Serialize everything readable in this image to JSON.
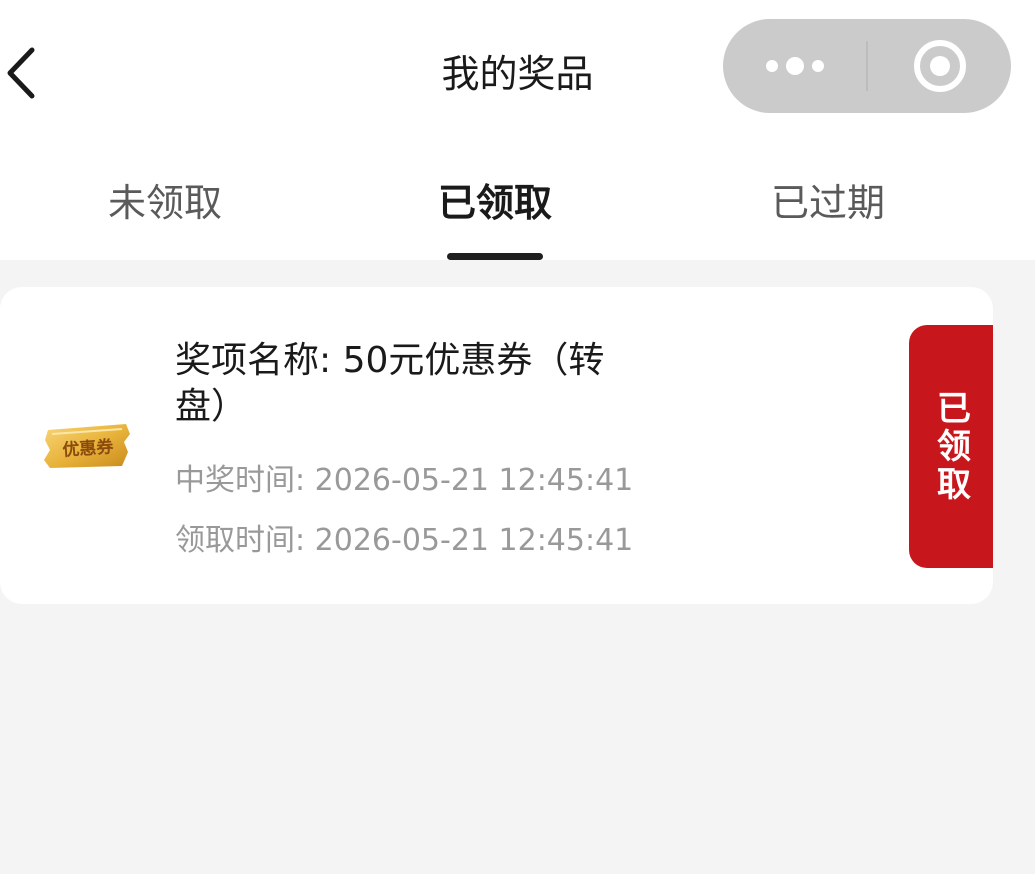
{
  "header": {
    "title": "我的奖品",
    "back_icon": "chevron-left-icon",
    "capsule": {
      "more_icon": "more-dots-icon",
      "close_icon": "target-close-icon"
    }
  },
  "tabs": [
    {
      "label": "未领取",
      "active": false
    },
    {
      "label": "已领取",
      "active": true
    },
    {
      "label": "已过期",
      "active": false
    }
  ],
  "prizes": [
    {
      "name": "奖项名称: 50元优惠券（转盘）",
      "coupon_badge_text": "优惠券",
      "won_time": "中奖时间: 2026-05-21 12:45:41",
      "claim_time": "领取时间: 2026-05-21 12:45:41",
      "status": "已领取"
    }
  ],
  "colors": {
    "page_background": "#f4f4f4",
    "card_background": "#ffffff",
    "status_red": "#c8161d",
    "coupon_gold": "#e9b43c",
    "secondary_text": "#999999",
    "capsule_gray": "#cbcbcb"
  }
}
